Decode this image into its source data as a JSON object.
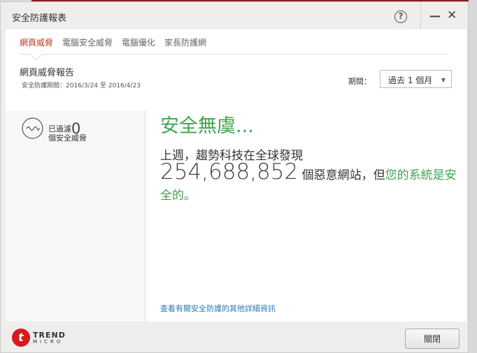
{
  "window": {
    "title": "安全防護報表",
    "help": "?",
    "minimize": "—",
    "close": "✕"
  },
  "tabs": [
    "網頁威脅",
    "電腦安全威脅",
    "電腦優化",
    "家長防護網"
  ],
  "report": {
    "title": "網頁威脅報告",
    "period_text": "安全防護期間：2016/3/24 至 2016/4/23",
    "period_label": "期間：",
    "period_value": "過去 1 個月",
    "arrow": "▼"
  },
  "left": {
    "filtered_label": "已過濾",
    "filtered_count": "0",
    "filtered_suffix": "個安全威脅"
  },
  "main": {
    "headline": "安全無虞...",
    "line1": "上週，趨勢科技在全球發現",
    "count": "254,688,852",
    "line2_mid": " 個惡意網站，但",
    "line2_green": "您的系統是安全的。",
    "more_link": "查看有關安全防護的其他詳細資訊"
  },
  "footer": {
    "logo_top": "TREND",
    "logo_bottom": "MICRO",
    "logo_glyph": "t",
    "close_button": "關閉"
  },
  "colors": {
    "accent_red": "#c0392b",
    "safe_green": "#3fa34d",
    "link_blue": "#2a7ab0"
  }
}
